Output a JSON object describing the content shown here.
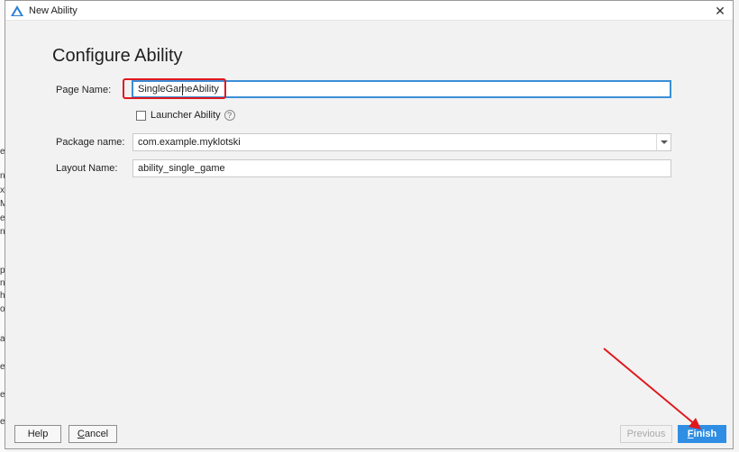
{
  "window": {
    "title": "New Ability",
    "close_icon": "close-icon",
    "app_icon": "harmony-app-icon"
  },
  "heading": "Configure Ability",
  "form": {
    "page_name": {
      "label": "Page Name:",
      "value": "SingleGameAbility"
    },
    "launcher": {
      "label": "Launcher Ability",
      "checked": false,
      "help_icon": "question-circle-icon"
    },
    "package": {
      "label": "Package name:",
      "value": "com.example.myklotski"
    },
    "layout": {
      "label": "Layout Name:",
      "value": "ability_single_game"
    }
  },
  "buttons": {
    "help": "Help",
    "cancel_prefix": "",
    "cancel_mnemonic": "C",
    "cancel_rest": "ancel",
    "previous": "Previous",
    "finish_mnemonic": "F",
    "finish_rest": "inish"
  },
  "annotations": {
    "highlight_color": "#e0181c",
    "accent": "#2f8ee3"
  },
  "background_letters": [
    "e",
    "n",
    "x",
    "M",
    "e",
    "n",
    "p",
    "n",
    "h",
    "o",
    "a",
    "e",
    "e",
    "e"
  ]
}
